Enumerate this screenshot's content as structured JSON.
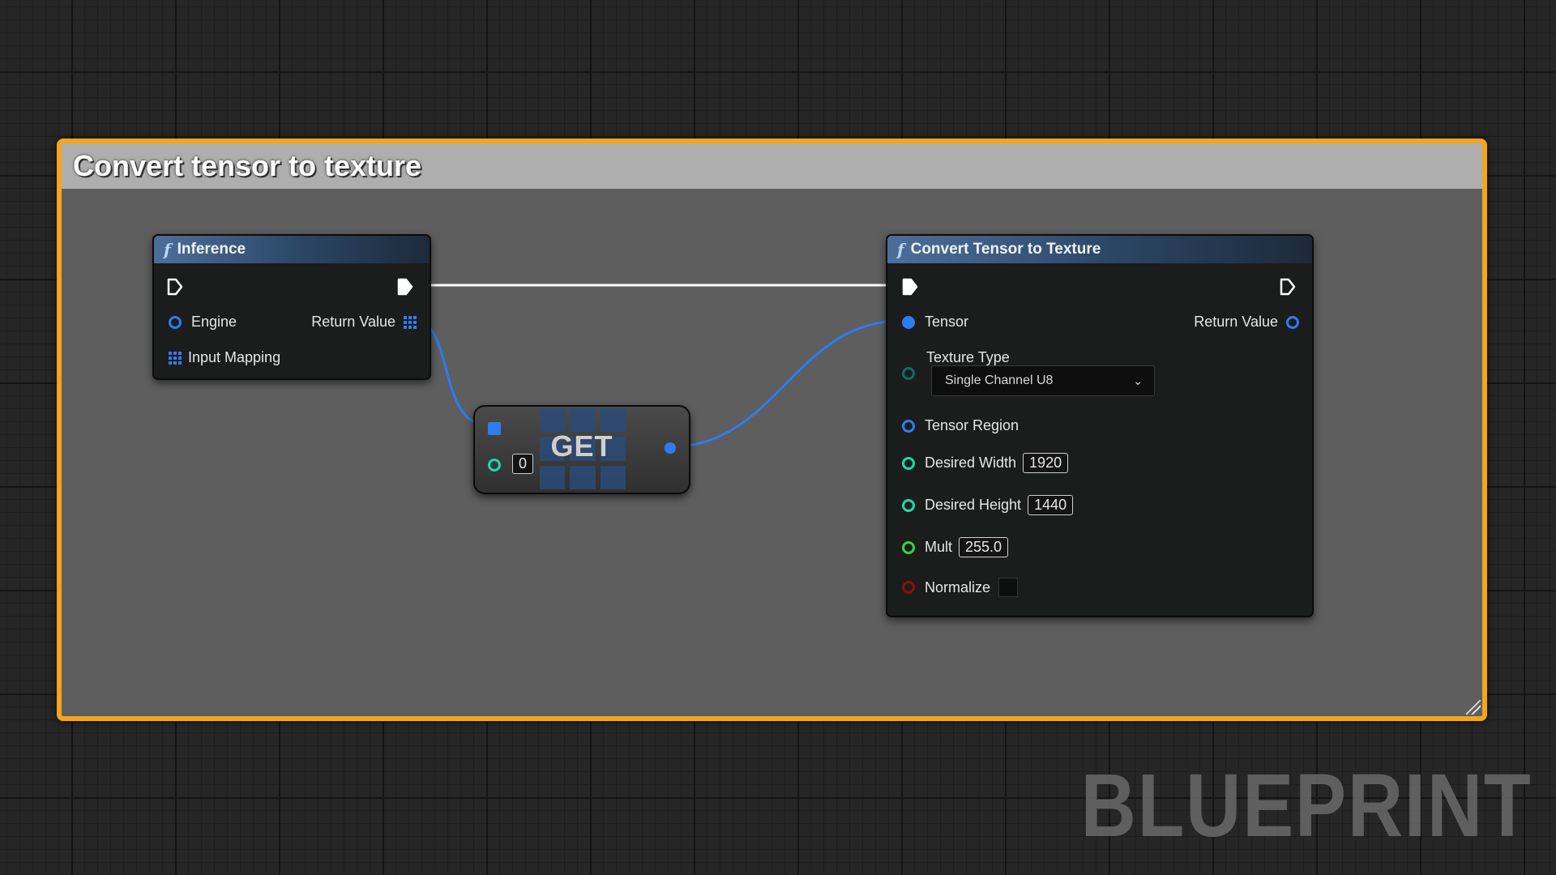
{
  "comment": {
    "title": "Convert tensor to texture"
  },
  "nodes": {
    "inference": {
      "title": "Inference",
      "inputs": {
        "engine": "Engine",
        "input_mapping": "Input Mapping"
      },
      "outputs": {
        "return_value": "Return Value"
      }
    },
    "get": {
      "label": "GET",
      "index": "0"
    },
    "convert": {
      "title": "Convert Tensor to Texture",
      "inputs": {
        "tensor": "Tensor",
        "texture_type": "Texture Type",
        "texture_type_value": "Single Channel U8",
        "tensor_region": "Tensor Region",
        "desired_width": "Desired Width",
        "desired_width_value": "1920",
        "desired_height": "Desired Height",
        "desired_height_value": "1440",
        "mult": "Mult",
        "mult_value": "255.0",
        "normalize": "Normalize"
      },
      "outputs": {
        "return_value": "Return Value"
      }
    }
  },
  "watermark": "BLUEPRINT",
  "colors": {
    "comment_border": "#f4a51d",
    "object_pin": "#2d7cf2",
    "int_pin": "#1fd9a6",
    "float_pin": "#3ad23a",
    "bool_pin": "#8c1010",
    "byte_pin": "#0f6d60",
    "exec_pin": "#ffffff"
  },
  "icons": {
    "function": "function-icon",
    "exec": "exec-pin-icon",
    "array": "array-pin-icon",
    "chevron": "chevron-down-icon"
  }
}
